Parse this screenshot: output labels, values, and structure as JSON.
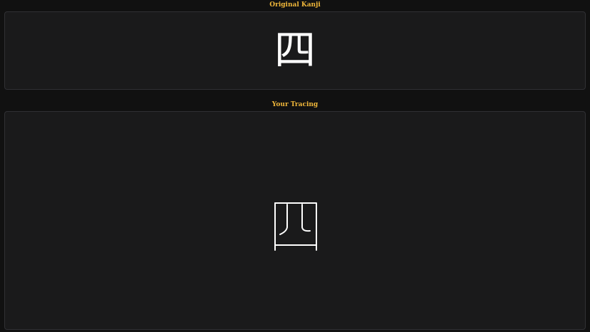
{
  "original": {
    "title": "Original Kanji",
    "kanji": "四"
  },
  "tracing": {
    "title": "Your Tracing",
    "stroke_color": "#ffffff"
  },
  "colors": {
    "background": "#111111",
    "panel": "#1a1a1b",
    "title": "#f0b73a"
  }
}
